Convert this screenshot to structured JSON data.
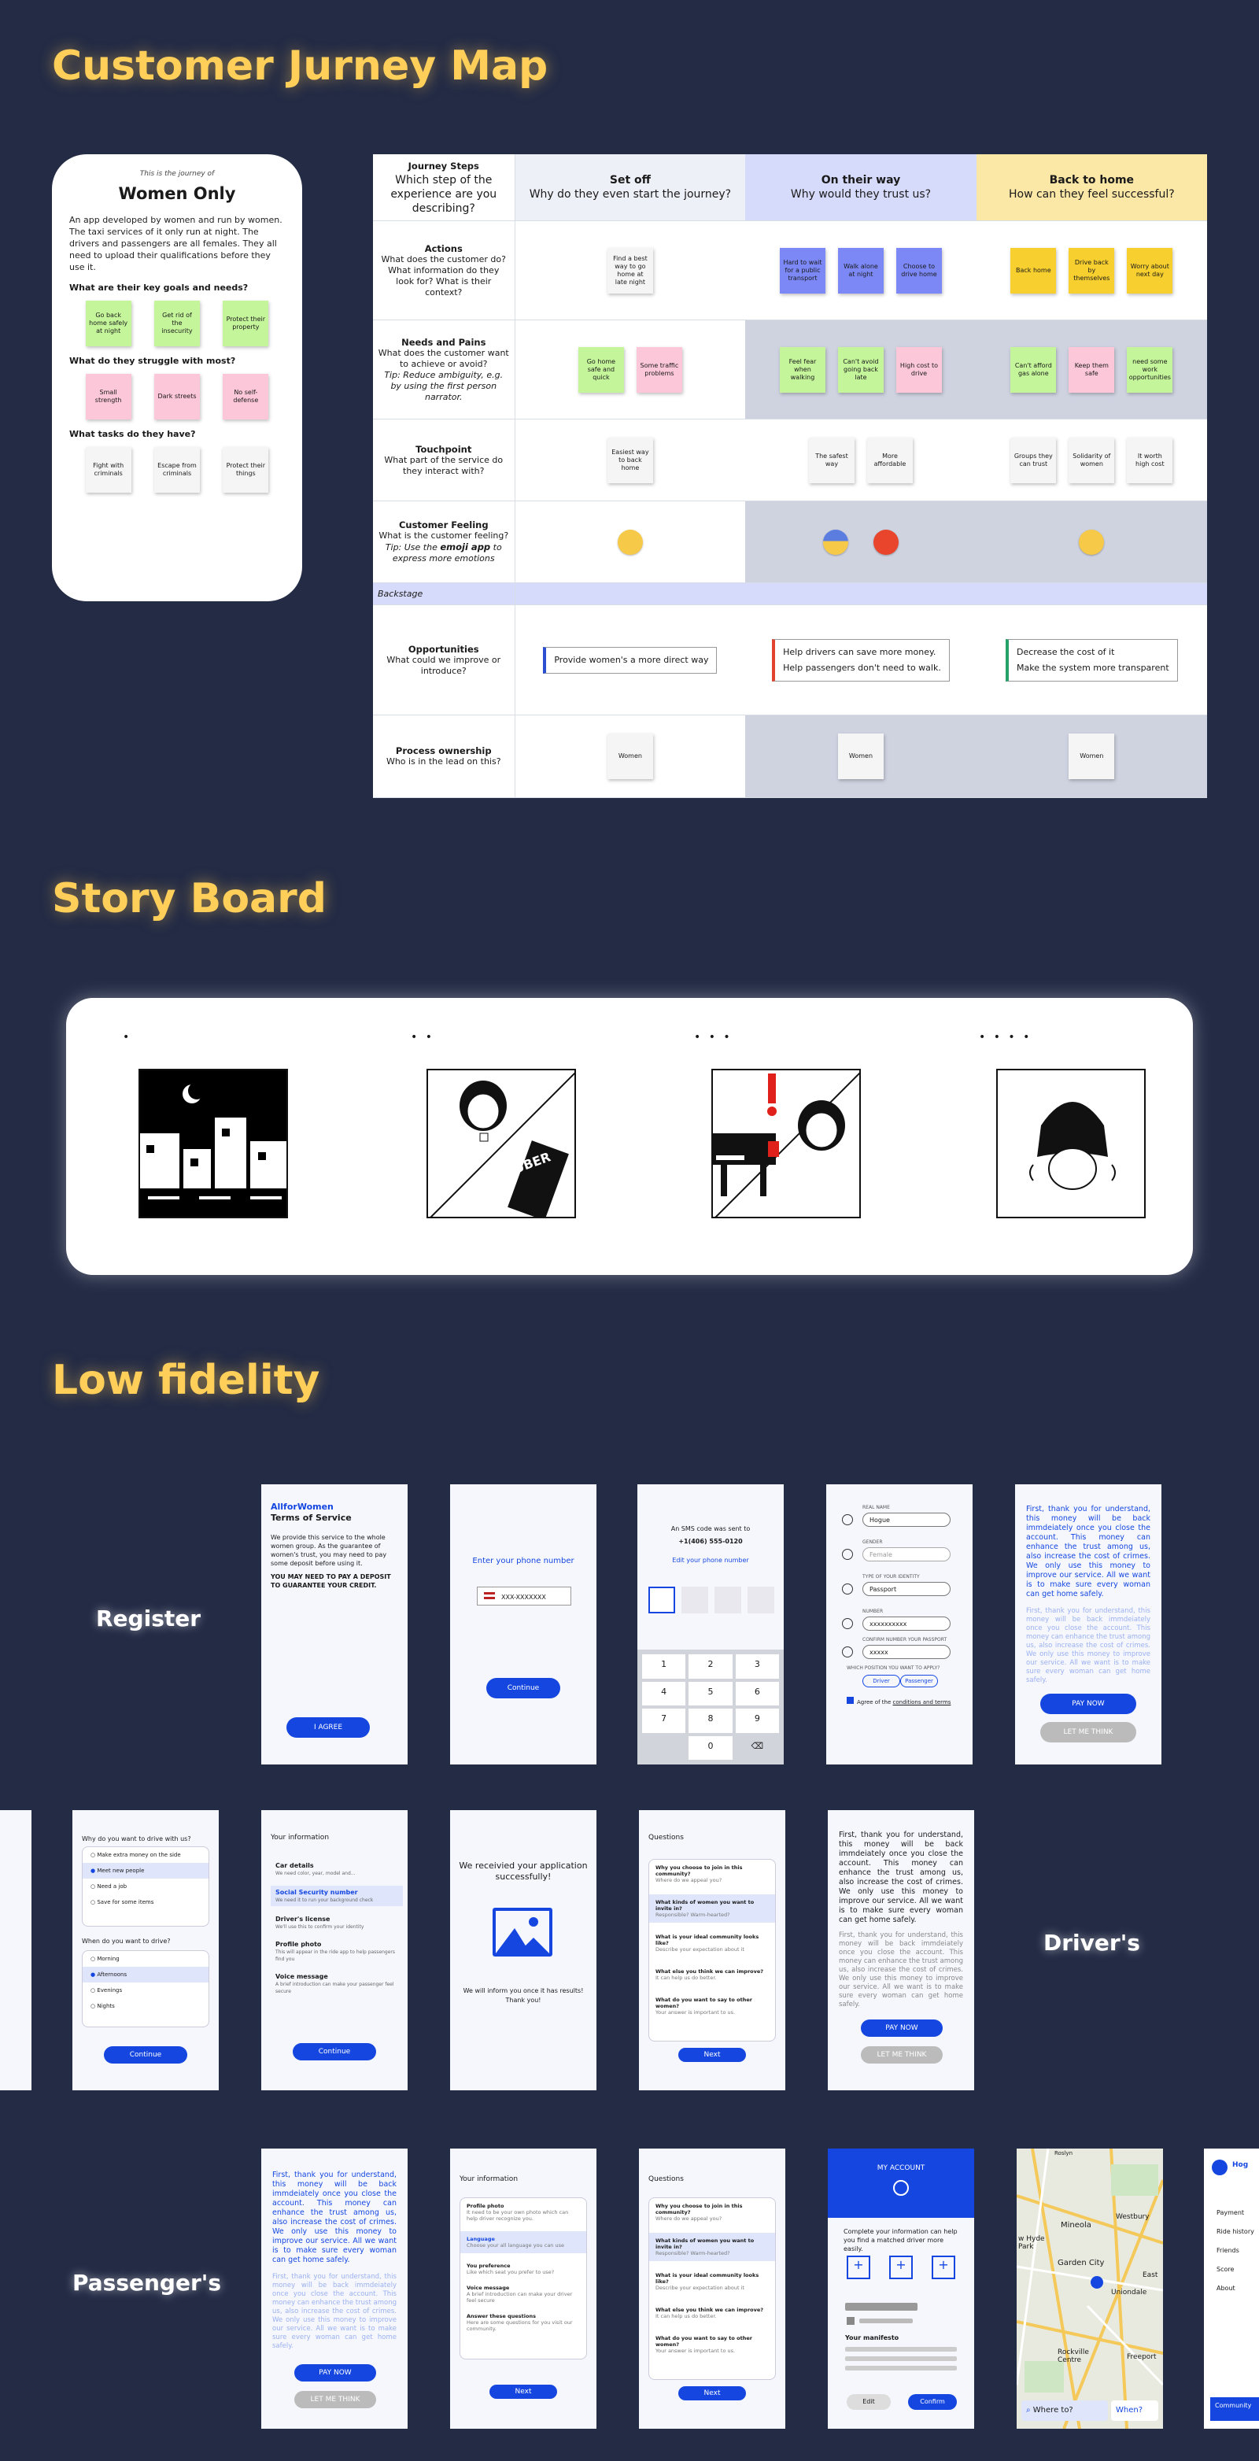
{
  "sections": {
    "journey": "Customer Jurney Map",
    "story": "Story Board",
    "lowfi": "Low fidelity"
  },
  "persona": {
    "intro": "This is the journey of",
    "name": "Women Only",
    "desc": "An app developed by women and run by women. The taxi services of it only run at night. The drivers and passengers are all females. They all need to upload their qualifications before they use it.",
    "goals_q": "What are their key goals and needs?",
    "goals": [
      "Go back home safely at night",
      "Get rid of the insecurity",
      "Protect their property"
    ],
    "struggle_q": "What do they struggle with most?",
    "struggles": [
      "Small strength",
      "Dark streets",
      "No self-defense"
    ],
    "tasks_q": "What tasks do they have?",
    "tasks": [
      "Fight with criminals",
      "Escape from criminals",
      "Protect their things"
    ]
  },
  "journey": {
    "head": {
      "title": "Journey Steps",
      "q": "Which step of the experience are you describing?"
    },
    "phases": [
      {
        "name": "Set off",
        "q": "Why do they even start the journey?"
      },
      {
        "name": "On their way",
        "q": "Why would they trust us?"
      },
      {
        "name": "Back to home",
        "q": "How can they feel successful?"
      }
    ],
    "actions": {
      "title": "Actions",
      "q": "What does the customer do? What information do they look for? What is their context?",
      "c1": [
        "Find a best way to go home at late night"
      ],
      "c2": [
        "Hard to wait for a public transport",
        "Walk alone at night",
        "Choose to drive home"
      ],
      "c3": [
        "Back home",
        "Drive back by themselves",
        "Worry about next day"
      ]
    },
    "needs": {
      "title": "Needs and Pains",
      "q": "What does the customer want to achieve or avoid?",
      "tip": "Tip: Reduce ambiguity, e.g. by using the first person narrator.",
      "c1": [
        "Go home safe and quick",
        "Some traffic problems"
      ],
      "c2": [
        "Feel fear when walking",
        "Can't avoid going back late",
        "High cost to drive"
      ],
      "c3": [
        "Can't afford gas alone",
        "Keep them safe",
        "need some work opportunities"
      ]
    },
    "touch": {
      "title": "Touchpoint",
      "q": "What part of the service do they interact with?",
      "c1": [
        "Easiest way to back home"
      ],
      "c2": [
        "The safest way",
        "More affordable"
      ],
      "c3": [
        "Groups they can trust",
        "Solidarity of women",
        "It worth high cost"
      ]
    },
    "feel": {
      "title": "Customer Feeling",
      "q": "What is the customer feeling?",
      "tip1": "Tip: Use the",
      "tip2": "emoji app",
      "tip3": "to express more emotions"
    },
    "backstage": "Backstage",
    "opp": {
      "title": "Opportunities",
      "q": "What could we improve or introduce?",
      "c1": [
        "Provide women's a more direct way"
      ],
      "c2": [
        "Help drivers can save more money.",
        "Help passengers don't need to walk."
      ],
      "c3": [
        "Decrease the cost of it",
        "Make the system more transparent"
      ]
    },
    "own": {
      "title": "Process ownership",
      "q": "Who is in the lead on this?",
      "c": "Women"
    }
  },
  "story": {
    "dots": [
      "•",
      "• •",
      "• • •",
      "• • • •"
    ],
    "uber": "UBER"
  },
  "labels": {
    "register": "Register",
    "drivers": "Driver's",
    "passengers": "Passenger's"
  },
  "reg": {
    "tos": {
      "brand": "AllforWomen",
      "title": "Terms of Service",
      "body": "We provide this service to the whole women group. As the guarantee of women's trust, you may need to pay some deposit before using it.",
      "caps": "YOU MAY NEED TO PAY A DEPOSIT TO GUARANTEE YOUR CREDIT.",
      "btn": "I AGREE"
    },
    "phone": {
      "title": "Enter your phone number",
      "ph": "XXX-XXXXXXX",
      "btn": "Continue"
    },
    "sms": {
      "t1": "An SMS code was sent to",
      "num": "+1(406) 555-0120",
      "edit": "Edit your phone number",
      "keys": [
        "1",
        "2",
        "3",
        "4",
        "5",
        "6",
        "7",
        "8",
        "9",
        "",
        "0",
        "⌫"
      ]
    },
    "form": {
      "l1": "REAL NAME",
      "v1": "Hogue",
      "l2": "GENDER",
      "v2": "Female",
      "l3": "TYPE OF YOUR IDENTITY",
      "v3": "Passport",
      "l4": "NUMBER",
      "v4": "xxxxxxxxxx",
      "l5": "CONFIRM NUMBER YOUR PASSPORT",
      "v5": "xxxxx",
      "l6": "WHICH POSITION YOU WANT TO APPLY?",
      "o1": "Driver",
      "o2": "Passenger",
      "agree": "Agree of the",
      "terms": "conditions and terms"
    },
    "pay": {
      "p1": "First, thank you for understand, this money will be back immdeiately once you close the account. This money can enhance the trust among us, also increase the cost of crimes. We only use this money to improve our service. All we want is to make sure every woman can get home safely.",
      "btn": "PAY NOW",
      "btn2": "LET ME THINK"
    }
  },
  "drv": {
    "q1": "Why do you want to drive with us?",
    "o1": [
      "Make extra money on the side",
      "Meet new people",
      "Need a job",
      "Save for some items"
    ],
    "q2": "When do you want to drive?",
    "o2": [
      "Morning",
      "Afternoons",
      "Evenings",
      "Nights"
    ],
    "btn": "Continue",
    "info": {
      "title": "Your information",
      "items": [
        {
          "t": "Car details",
          "s": "We need color, year, model and..."
        },
        {
          "t": "Social Security number",
          "s": "We need it to run your background check"
        },
        {
          "t": "Driver's license",
          "s": "We'll use this to confirm your identity"
        },
        {
          "t": "Profile photo",
          "s": "This will appear in the ride app to help passengers find you"
        },
        {
          "t": "Voice message",
          "s": "A brief introduction can make your passenger feel secure"
        }
      ]
    },
    "recv": {
      "t": "We receivied your application successfully!",
      "s": "We will inform you once it has results! Thank you!"
    },
    "qs": {
      "title": "Questions",
      "items": [
        {
          "t": "Why you choose to join in this community?",
          "s": "Where do we appeal you?"
        },
        {
          "t": "What kinds of women you want to invite in?",
          "s": "Responsible? Warm-hearted?"
        },
        {
          "t": "What is your ideal community looks like?",
          "s": "Describe your expectation about it"
        },
        {
          "t": "What else you think we can improve?",
          "s": "It can help us do better."
        },
        {
          "t": "What do you want to say to other women?",
          "s": "Your answer is important to us."
        }
      ],
      "btn": "Next"
    }
  },
  "pas": {
    "info": {
      "title": "Your information",
      "items": [
        {
          "t": "Profile photo",
          "s": "It need to be your own photo which can help driver recognize you."
        },
        {
          "t": "Language",
          "s": "Choose your all language you can use"
        },
        {
          "t": "You preference",
          "s": "Like which seat you prefer to use?"
        },
        {
          "t": "Voice message",
          "s": "A brief introduction can make your driver feel secure"
        },
        {
          "t": "Answer these questions",
          "s": "Here are some questions for you visit our community."
        }
      ],
      "btn": "Next"
    },
    "acct": {
      "title": "MY ACCOUNT",
      "s": "Complete your information can help you find a matched driver more easily.",
      "m": "Your manifesto",
      "b1": "Edit",
      "b2": "Confirm"
    },
    "map": {
      "p1": "Mineola",
      "p2": "Westbury",
      "p3": "Garden City",
      "p4": "Uniondale",
      "p5": "East",
      "p6": "Rockville Centre",
      "p7": "Freeport",
      "p8": "Roslyn",
      "p9": "w Hyde Park",
      "where": "Where to?",
      "when": "When?"
    },
    "menu": {
      "name": "Hog",
      "items": [
        "Payment",
        "Ride history",
        "Friends",
        "Score",
        "About"
      ],
      "comm": "Community"
    }
  }
}
